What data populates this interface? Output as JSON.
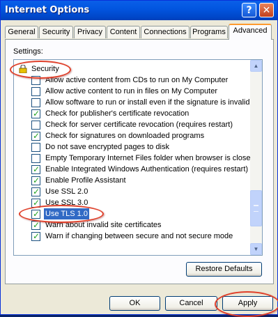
{
  "window": {
    "title": "Internet Options"
  },
  "titlebar": {
    "help_glyph": "?",
    "close_glyph": "✕"
  },
  "tabs": [
    "General",
    "Security",
    "Privacy",
    "Content",
    "Connections",
    "Programs",
    "Advanced"
  ],
  "active_tab": "Advanced",
  "settings": {
    "label": "Settings:",
    "category": "Security",
    "items": [
      {
        "label": "Allow active content from CDs to run on My Computer",
        "checked": false
      },
      {
        "label": "Allow active content to run in files on My Computer",
        "checked": false
      },
      {
        "label": "Allow software to run or install even if the signature is invalid",
        "checked": false
      },
      {
        "label": "Check for publisher's certificate revocation",
        "checked": true
      },
      {
        "label": "Check for server certificate revocation (requires restart)",
        "checked": false
      },
      {
        "label": "Check for signatures on downloaded programs",
        "checked": true
      },
      {
        "label": "Do not save encrypted pages to disk",
        "checked": false
      },
      {
        "label": "Empty Temporary Internet Files folder when browser is closed",
        "checked": false
      },
      {
        "label": "Enable Integrated Windows Authentication (requires restart)",
        "checked": true
      },
      {
        "label": "Enable Profile Assistant",
        "checked": true
      },
      {
        "label": "Use SSL 2.0",
        "checked": true
      },
      {
        "label": "Use SSL 3.0",
        "checked": true
      },
      {
        "label": "Use TLS 1.0",
        "checked": true,
        "selected": true
      },
      {
        "label": "Warn about invalid site certificates",
        "checked": true
      },
      {
        "label": "Warn if changing between secure and not secure mode",
        "checked": true
      }
    ]
  },
  "buttons": {
    "restore_defaults": "Restore Defaults",
    "ok": "OK",
    "cancel": "Cancel",
    "apply": "Apply"
  },
  "colors": {
    "annotation": "#e0402a",
    "selection": "#316ac5",
    "checkmark": "#21a121",
    "active_tab_accent": "#ff9a2e"
  }
}
